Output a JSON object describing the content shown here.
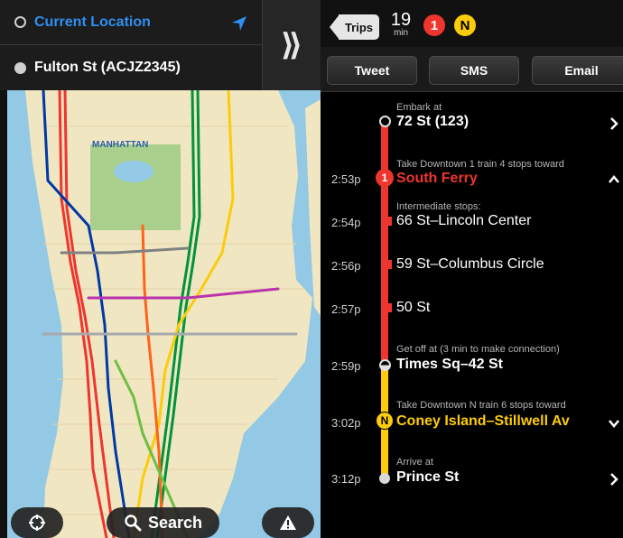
{
  "origin": {
    "label": "Current Location",
    "color": "#2f8ff0"
  },
  "destination": {
    "label": "Fulton St (ACJZ2345)"
  },
  "toggle": {
    "glyph": "⟫"
  },
  "map": {
    "labels": {
      "borough": "MANHATTAN"
    },
    "colors": {
      "water": "#93c9e4",
      "land": "#f1e6c2",
      "park": "#a8cf8c"
    }
  },
  "map_buttons": {
    "search": "Search"
  },
  "trip": {
    "back_label": "Trips",
    "duration_value": "19",
    "duration_unit": "min",
    "lines": [
      {
        "label": "1",
        "color": "#ee352e"
      },
      {
        "label": "N",
        "color": "#fccc0a"
      }
    ]
  },
  "share": {
    "tweet": "Tweet",
    "sms": "SMS",
    "email": "Email"
  },
  "itinerary": {
    "embark": {
      "caption": "Embark at",
      "station": "72 St (123)"
    },
    "leg1": {
      "time": "2:53p",
      "caption": "Take Downtown 1 train 4 stops toward",
      "terminal": "South Ferry",
      "line": "1",
      "intermediate_caption": "Intermediate stops:",
      "stops": [
        {
          "time": "2:54p",
          "name": "66 St–Lincoln Center"
        },
        {
          "time": "2:56p",
          "name": "59 St–Columbus Circle"
        },
        {
          "time": "2:57p",
          "name": "50 St"
        }
      ]
    },
    "transfer": {
      "time": "2:59p",
      "caption": "Get off at (3 min to make connection)",
      "station": "Times Sq–42 St"
    },
    "leg2": {
      "time": "3:02p",
      "caption": "Take Downtown N train 6 stops toward",
      "terminal": "Coney Island–Stillwell Av",
      "line": "N"
    },
    "arrive": {
      "time": "3:12p",
      "caption": "Arrive at",
      "station": "Prince St"
    }
  }
}
